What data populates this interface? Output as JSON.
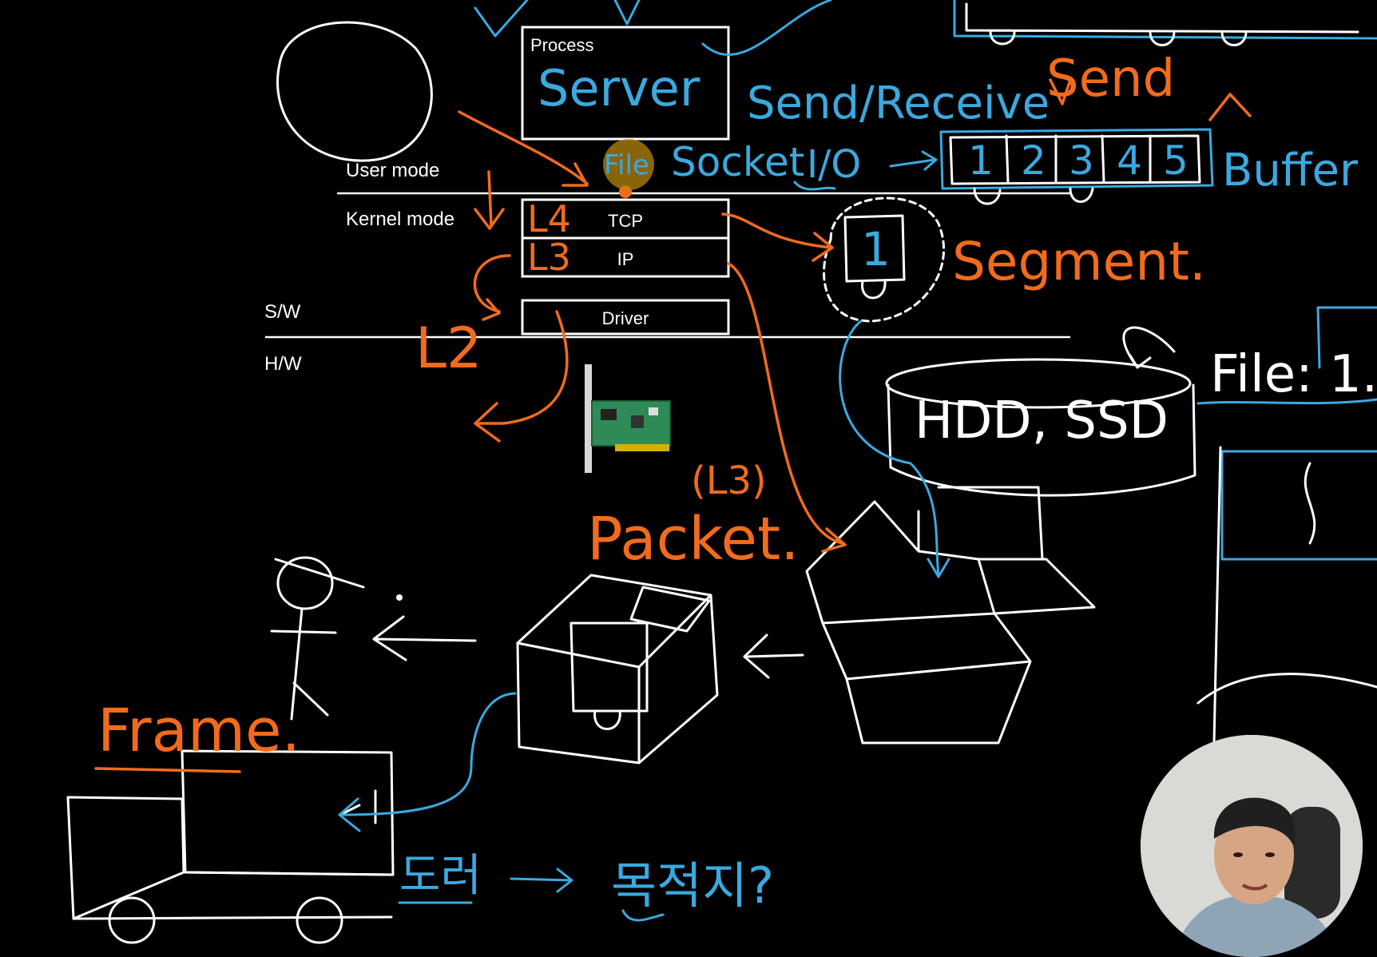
{
  "diagram": {
    "process_label": "Process",
    "server_label": "Server",
    "user_mode_label": "User mode",
    "kernel_mode_label": "Kernel mode",
    "tcp_label": "TCP",
    "ip_label": "IP",
    "driver_label": "Driver",
    "sw_label": "S/W",
    "hw_label": "H/W"
  },
  "annotations": {
    "l4": "L4",
    "l3": "L3",
    "l2": "L2",
    "file": "File",
    "socket": "Socket",
    "io": "I/O",
    "send_receive": "Send/Receive",
    "send": "Send",
    "buffer": "Buffer",
    "buffer_cells": [
      "1",
      "2",
      "3",
      "4",
      "5"
    ],
    "segment_number": "1",
    "segment": "Segment.",
    "hdd_ssd": "HDD, SSD",
    "file_right": "File: 1.",
    "packet_layer": "(L3)",
    "packet": "Packet.",
    "frame": "Frame.",
    "korean_left": "도러",
    "korean_right": "목적지?"
  },
  "colors": {
    "background": "#000000",
    "chalk_white": "#ffffff",
    "marker_orange": "#f26b1d",
    "marker_blue": "#3aa9e0",
    "highlight": "#b8860b"
  },
  "icons": {
    "nic": "network-card-icon",
    "webcam": "presenter-webcam"
  }
}
